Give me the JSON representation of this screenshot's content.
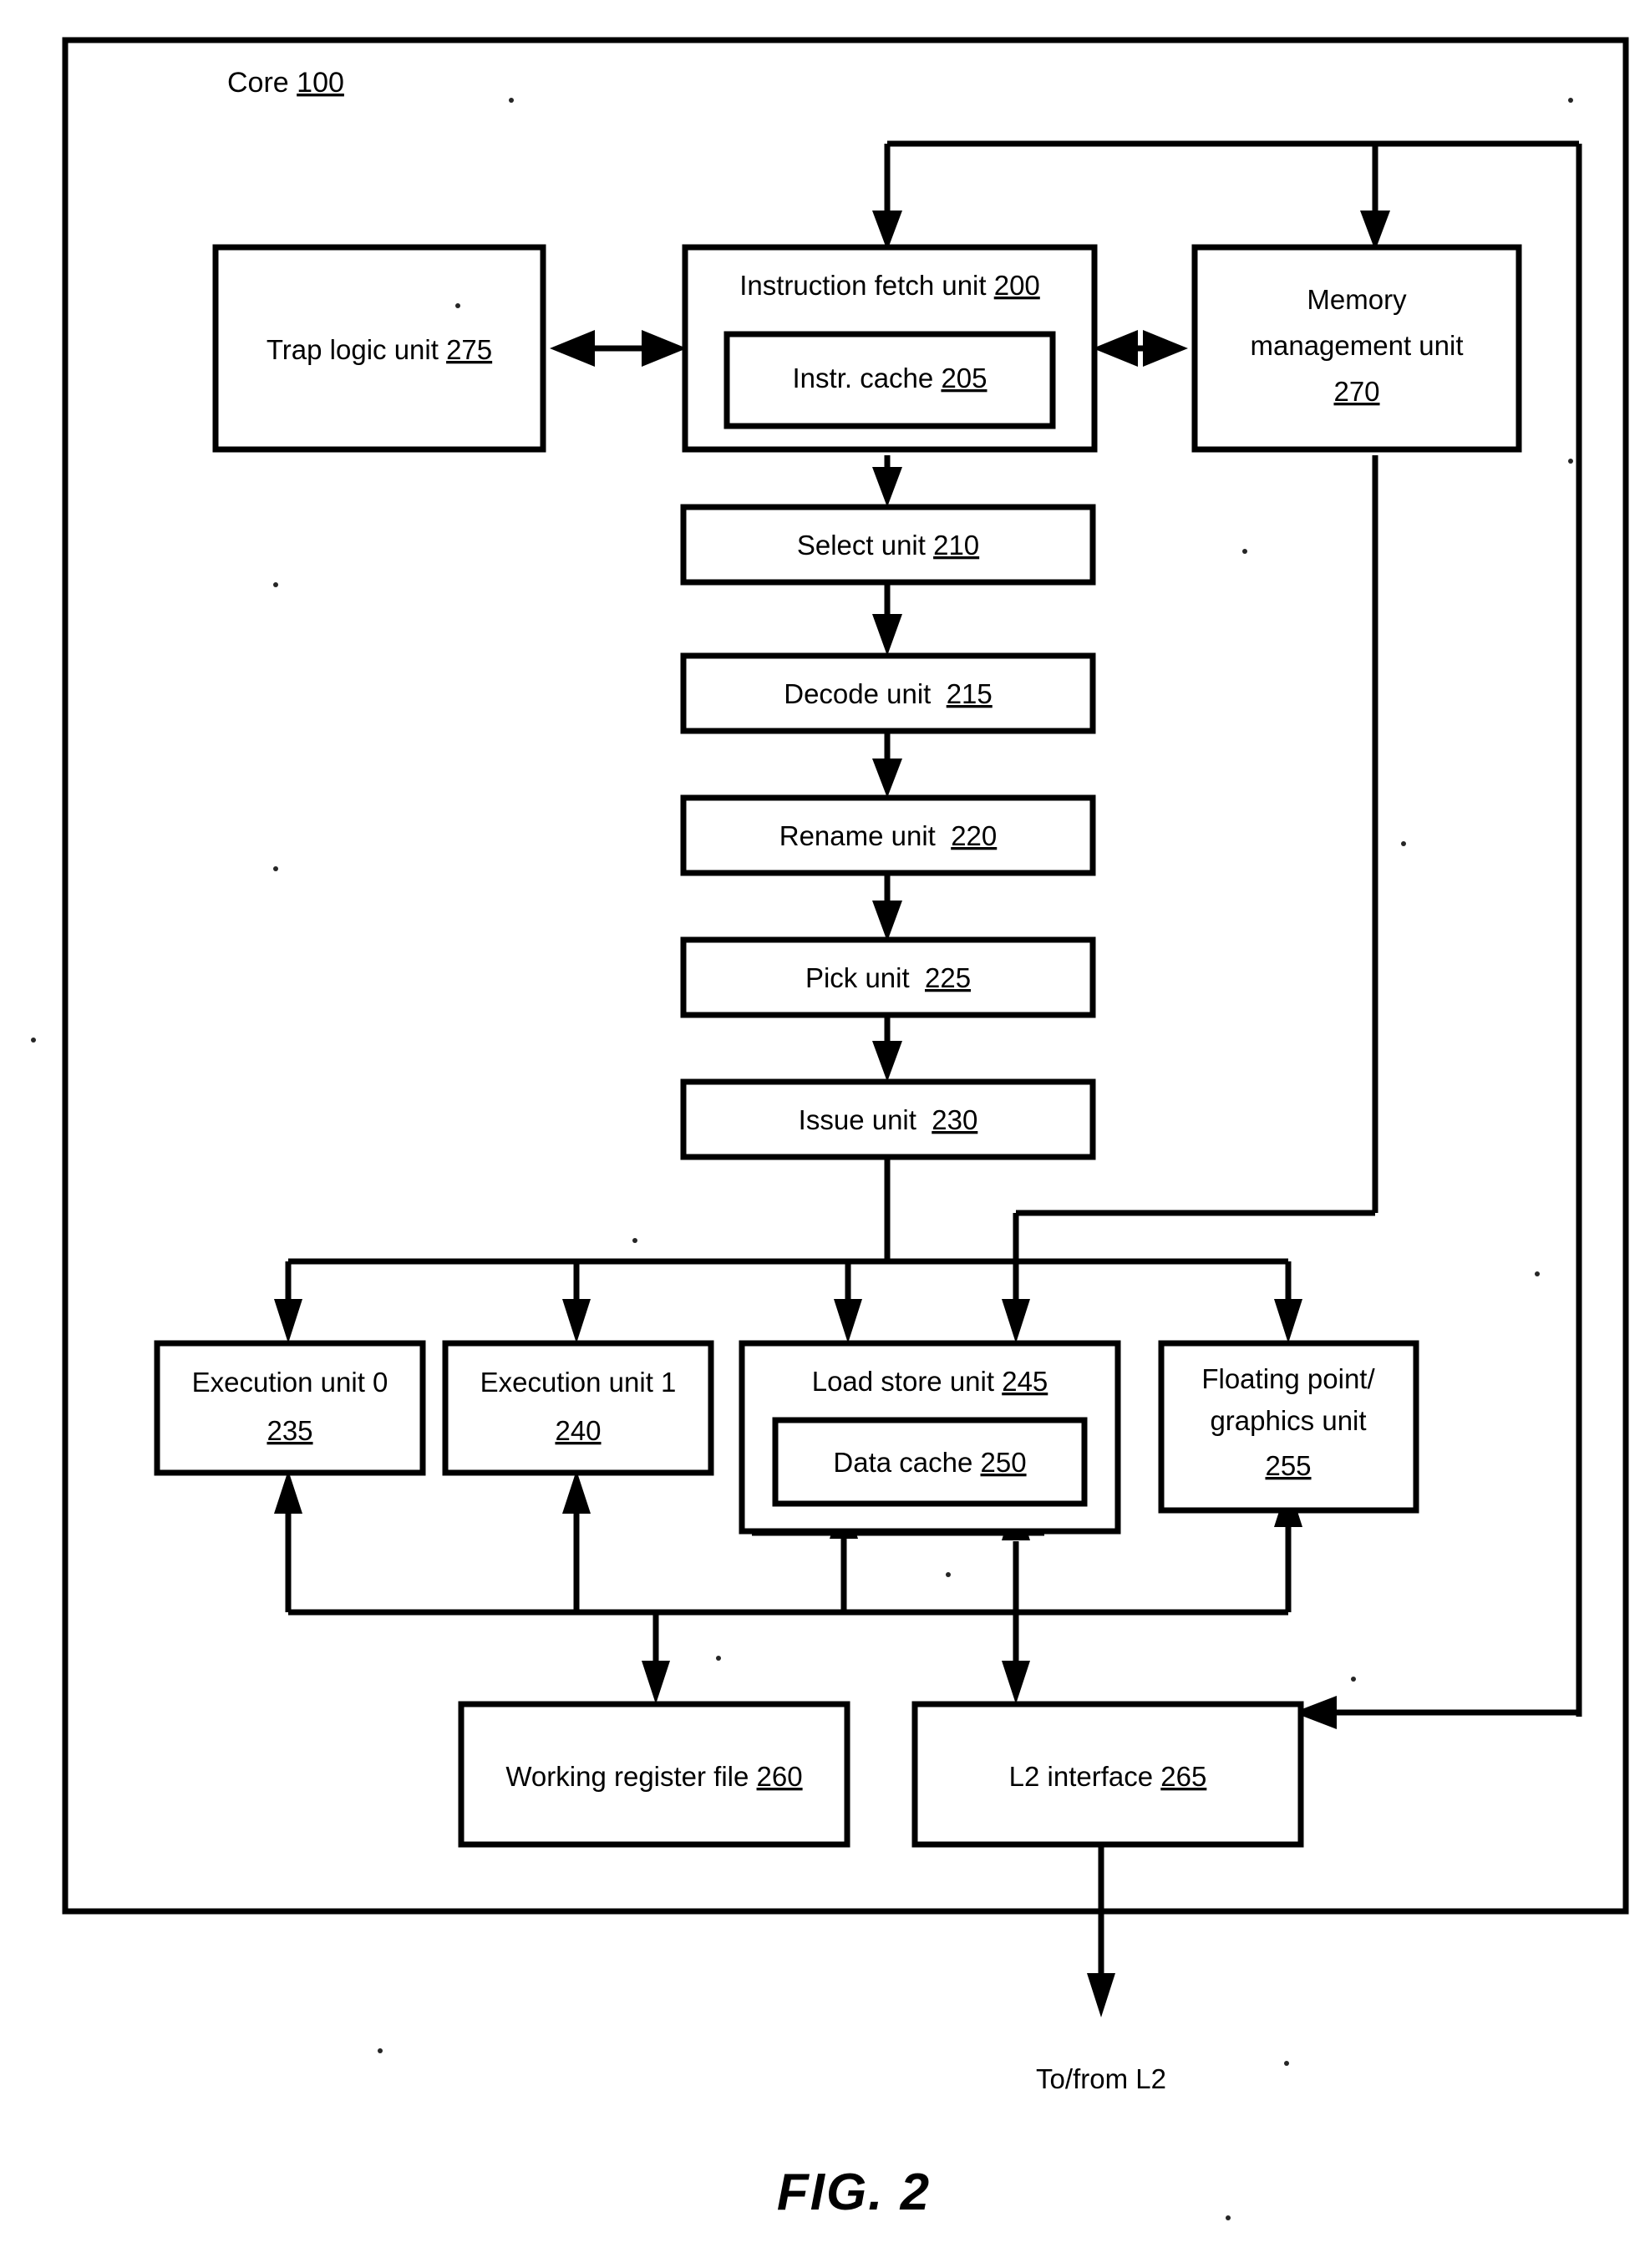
{
  "figure": {
    "label": "FIG. 2",
    "outer_block_title": "Core",
    "outer_block_number": "100",
    "bottom_caption": "To/from L2"
  },
  "blocks": {
    "trap_logic": {
      "title": "Trap logic unit",
      "number": "275"
    },
    "instruction_fetch": {
      "title": "Instruction fetch unit",
      "number": "200"
    },
    "instr_cache": {
      "title": "Instr. cache",
      "number": "205"
    },
    "memory_management": {
      "title_line1": "Memory",
      "title_line2": "management unit",
      "number": "270"
    },
    "select_unit": {
      "title": "Select unit",
      "number": "210"
    },
    "decode_unit": {
      "title": "Decode unit",
      "number": "215"
    },
    "rename_unit": {
      "title": "Rename unit",
      "number": "220"
    },
    "pick_unit": {
      "title": "Pick unit",
      "number": "225"
    },
    "issue_unit": {
      "title": "Issue unit",
      "number": "230"
    },
    "execution_unit_0": {
      "title": "Execution unit 0",
      "number": "235"
    },
    "execution_unit_1": {
      "title": "Execution unit 1",
      "number": "240"
    },
    "load_store_unit": {
      "title": "Load store unit",
      "number": "245"
    },
    "data_cache": {
      "title": "Data cache",
      "number": "250"
    },
    "fp_graphics_unit": {
      "title_line1": "Floating point/",
      "title_line2": "graphics unit",
      "number": "255"
    },
    "working_register_file": {
      "title": "Working register file",
      "number": "260"
    },
    "l2_interface": {
      "title": "L2 interface",
      "number": "265"
    }
  },
  "colors": {
    "stroke": "#000000",
    "fill": "#ffffff"
  }
}
